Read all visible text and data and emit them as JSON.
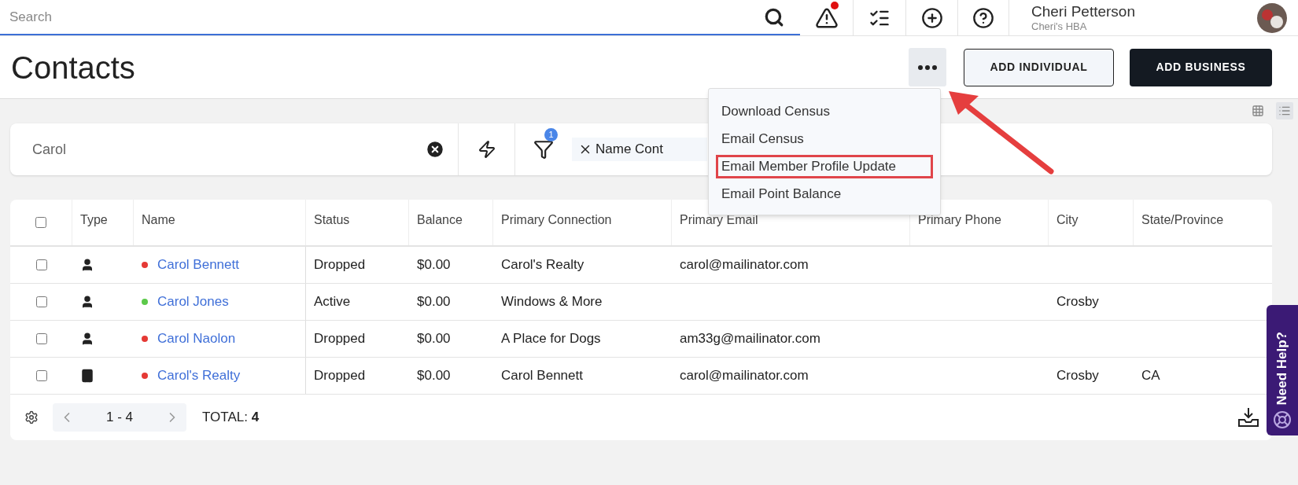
{
  "topbar": {
    "search_placeholder": "Search",
    "alerts_badge": true,
    "user": {
      "name": "Cheri Petterson",
      "org": "Cheri's HBA"
    }
  },
  "page": {
    "title": "Contacts",
    "buttons": [
      {
        "label": "ADD INDIVIDUAL",
        "kind": "outline"
      },
      {
        "label": "ADD BUSINESS",
        "kind": "solid"
      }
    ]
  },
  "menu": {
    "items": [
      {
        "label": "Download Census",
        "highlighted": false
      },
      {
        "label": "Email Census",
        "highlighted": false
      },
      {
        "label": "Email Member Profile Update",
        "highlighted": true
      },
      {
        "label": "Email Point Balance",
        "highlighted": false
      }
    ]
  },
  "view_toggle": [
    {
      "kind": "grid",
      "selected": false
    },
    {
      "kind": "list",
      "selected": true
    }
  ],
  "filter_bar": {
    "search_value": "Carol",
    "filter_count": "1",
    "chip": "Name Cont"
  },
  "table": {
    "select_all_checked": false,
    "columns": [
      "Type",
      "Name",
      "Status",
      "Balance",
      "Primary Connection",
      "Primary Email",
      "Primary Phone",
      "City",
      "State/Province"
    ],
    "rows": [
      {
        "kind": "person",
        "color": "#e53935",
        "name": "Carol Bennett",
        "status": "Dropped",
        "balance": "$0.00",
        "connection": "Carol's Realty",
        "email": "carol@mailinator.com",
        "checked": false
      },
      {
        "kind": "person",
        "color": "#5cc94a",
        "name": "Carol Jones",
        "status": "Active",
        "balance": "$0.00",
        "connection": "Windows & More",
        "city": "Crosby",
        "checked": false
      },
      {
        "kind": "person",
        "color": "#e53935",
        "name": "Carol Naolon",
        "status": "Dropped",
        "balance": "$0.00",
        "connection": "A Place for Dogs",
        "email": "am33g@mailinator.com",
        "checked": false
      },
      {
        "kind": "business",
        "color": "#e53935",
        "name": "Carol's Realty",
        "status": "Dropped",
        "balance": "$0.00",
        "connection": "Carol Bennett",
        "email": "carol@mailinator.com",
        "city": "Crosby",
        "state": "CA",
        "checked": false
      }
    ]
  },
  "footer": {
    "range": "1 - 4",
    "total": "TOTAL: **4**"
  },
  "help_tab": {
    "label": "Need Help?"
  }
}
